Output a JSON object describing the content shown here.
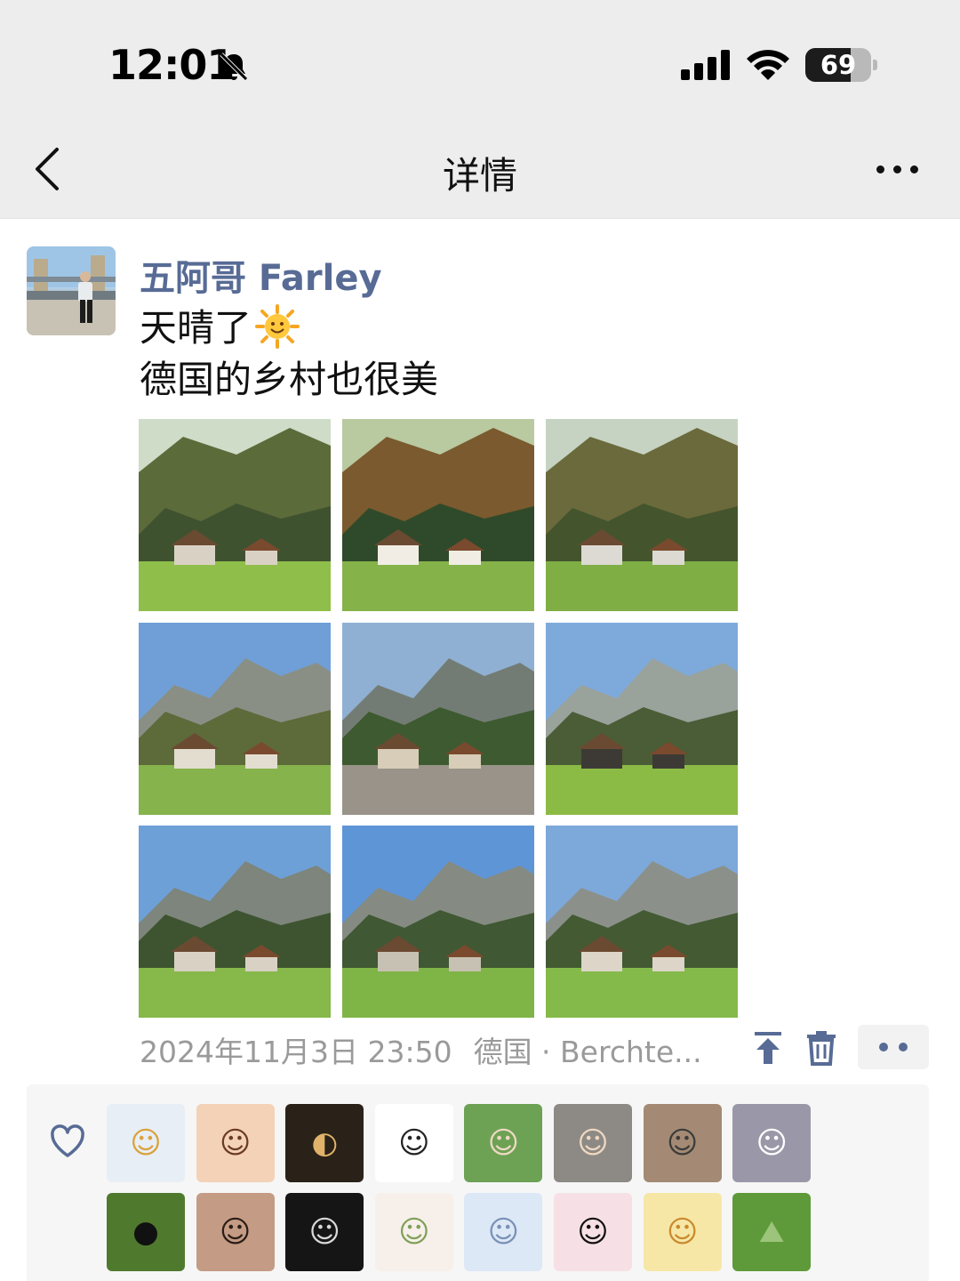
{
  "status_bar": {
    "time": "12:01",
    "battery": "69",
    "battery_level": 0.69
  },
  "nav": {
    "title": "详情"
  },
  "post": {
    "author": "五阿哥 Farley",
    "text_line1": "天晴了",
    "text_line2": "德国的乡村也很美",
    "timestamp": "2024年11月3日 23:50",
    "location": "德国 · Berchte..."
  },
  "photos": [
    {
      "name": "village-hillside",
      "sky": "#cfdcc8",
      "hill": "#5c6b3a",
      "forest": "#3f5230",
      "ground": "#8fbf4a",
      "accent": "#d9d2c4"
    },
    {
      "name": "chalet-forest",
      "sky": "#b9c9a0",
      "hill": "#7a5a2e",
      "forest": "#2f4a2a",
      "ground": "#86b24a",
      "accent": "#f1ede4"
    },
    {
      "name": "village-valley",
      "sky": "#c6d3c2",
      "hill": "#6b6a3c",
      "forest": "#44552e",
      "ground": "#7fae44",
      "accent": "#dcdad3"
    },
    {
      "name": "mountain-tree",
      "sky": "#6f9fd6",
      "hill": "#8a8f86",
      "forest": "#5d6b3a",
      "ground": "#86b34c",
      "accent": "#e3ddd0"
    },
    {
      "name": "mountain-street",
      "sky": "#8fb0d2",
      "hill": "#737c74",
      "forest": "#3e5a30",
      "ground": "#9a9389",
      "accent": "#d7cdb8"
    },
    {
      "name": "alpine-house",
      "sky": "#7eaadb",
      "hill": "#9aa29c",
      "forest": "#4a5d36",
      "ground": "#8cbb45",
      "accent": "#3d3a36"
    },
    {
      "name": "mountains-meadow",
      "sky": "#6ea0d8",
      "hill": "#7d857c",
      "forest": "#3e5430",
      "ground": "#86b84a",
      "accent": "#d9d1c4"
    },
    {
      "name": "mountain-path",
      "sky": "#5e95d6",
      "hill": "#858b82",
      "forest": "#405833",
      "ground": "#7fb446",
      "accent": "#c7c1b3"
    },
    {
      "name": "valley-field",
      "sky": "#7da8da",
      "hill": "#8b918a",
      "forest": "#435a33",
      "ground": "#84ba4a",
      "accent": "#dcd5c8"
    }
  ],
  "likers": [
    {
      "name": "liker-anime-boy",
      "bg": "#e8eef5",
      "fg": "#d9a23a",
      "glyph": "☺"
    },
    {
      "name": "liker-girl-orange",
      "bg": "#f3d2b8",
      "fg": "#6b3b22",
      "glyph": "☺"
    },
    {
      "name": "liker-window-light",
      "bg": "#2a2218",
      "fg": "#e0b26a",
      "glyph": "◐"
    },
    {
      "name": "liker-doodle",
      "bg": "#ffffff",
      "fg": "#222222",
      "glyph": "☺"
    },
    {
      "name": "liker-grass-girl",
      "bg": "#6da255",
      "fg": "#f0d9c4",
      "glyph": "☺"
    },
    {
      "name": "liker-boy-phone",
      "bg": "#8d8a86",
      "fg": "#f0d8c0",
      "glyph": "☺"
    },
    {
      "name": "liker-cat-brown",
      "bg": "#a48a74",
      "fg": "#3b3b3b",
      "glyph": "☺"
    },
    {
      "name": "liker-cat-meme",
      "bg": "#9a98a8",
      "fg": "#ffffff",
      "glyph": "☺"
    },
    {
      "name": "liker-green-hood",
      "bg": "#4f7a2e",
      "fg": "#111111",
      "glyph": "●"
    },
    {
      "name": "liker-girl-teddy",
      "bg": "#c49b84",
      "fg": "#2a1c16",
      "glyph": "☺"
    },
    {
      "name": "liker-dark-figure",
      "bg": "#151515",
      "fg": "#d8d8d8",
      "glyph": "☺"
    },
    {
      "name": "liker-cartoon-sketch",
      "bg": "#f7f0ea",
      "fg": "#7fa05a",
      "glyph": "☺"
    },
    {
      "name": "liker-anime-girl-blue",
      "bg": "#dce8f6",
      "fg": "#7a90b6",
      "glyph": "☺"
    },
    {
      "name": "liker-cartoon-boy",
      "bg": "#f6e0e6",
      "fg": "#111111",
      "glyph": "☺"
    },
    {
      "name": "liker-cat-cake",
      "bg": "#f7e7a6",
      "fg": "#c98a2e",
      "glyph": "☺"
    },
    {
      "name": "liker-grass-field",
      "bg": "#5f9a3a",
      "fg": "#9cc47a",
      "glyph": "⛰"
    }
  ]
}
